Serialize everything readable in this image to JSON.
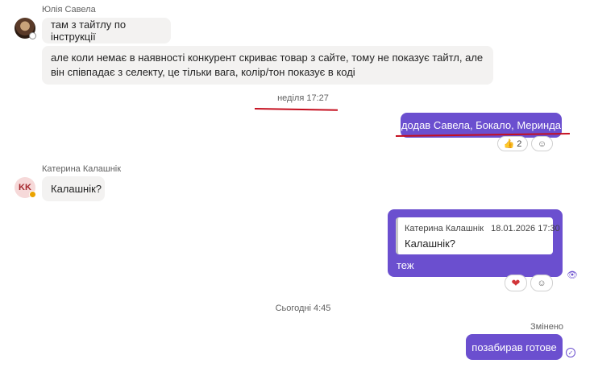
{
  "conversation": {
    "group1": {
      "sender": "Юлія Савела",
      "messages": [
        "там з тайтлу по інструкції",
        "але коли немає в наявності конкурент скриває товар з сайте, тому не показує тайтл, але він співпадає з селекту, це тільки вага, колір/тон показує в коді"
      ]
    },
    "separator1": "неділя 17:27",
    "outgoing1": {
      "text": "додав Савела, Бокало, Меринда",
      "reaction_count": "2"
    },
    "group2": {
      "sender": "Катерина Калашнік",
      "avatar_initials": "KK",
      "message": "Калашнік?"
    },
    "outgoing2": {
      "quote_author": "Катерина Калашнік",
      "quote_time": "18.01.2026 17:30",
      "quote_text": "Калашнік?",
      "text": "теж"
    },
    "separator2": "Сьогодні 4:45",
    "outgoing3": {
      "edited_label": "Змінено",
      "text": "позабирав готове"
    }
  },
  "colors": {
    "outgoing_bubble": "#6b4fcf",
    "incoming_bubble": "#f3f2f1",
    "annotation_red": "#c50f1f"
  }
}
